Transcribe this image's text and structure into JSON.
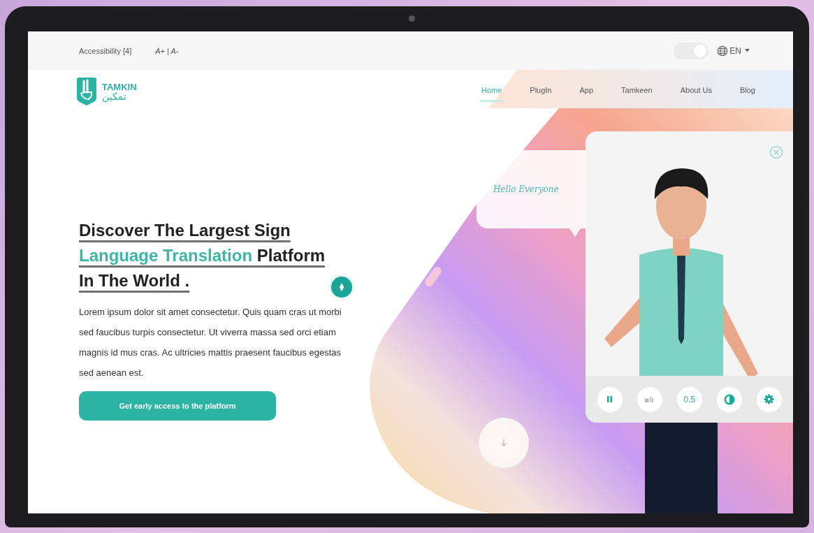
{
  "top_bar": {
    "accessibility_label": "Accessibility [4]",
    "font_size_controls": "A+ | A-",
    "dark_mode": {
      "on": true
    },
    "language": {
      "label": "EN"
    }
  },
  "brand": {
    "name": "TAMKIN",
    "name_arabic": "تمكين"
  },
  "nav": [
    {
      "label": "Home",
      "selected": true
    },
    {
      "label": "PlugIn",
      "selected": false
    },
    {
      "label": "App",
      "selected": false
    },
    {
      "label": "Tamkeen",
      "selected": false
    },
    {
      "label": "About Us",
      "selected": false
    },
    {
      "label": "Blog",
      "selected": false
    }
  ],
  "hero": {
    "heading_lines": [
      [
        {
          "text": "Discover The Largest Sign",
          "highlight": false
        }
      ],
      [
        {
          "text": "Language Translation",
          "highlight": true
        },
        {
          "text": " Platform",
          "highlight": false
        }
      ],
      [
        {
          "text": "In The World .",
          "highlight": false
        }
      ]
    ],
    "paragraph": "Lorem ipsum dolor sit amet consectetur. Quis quam cras ut morbi sed faucibus turpis consectetur. Ut viverra massa sed orci etiam magnis id mus cras. Ac ultricies mattis praesent faucibus egestas sed aenean est.",
    "cta_button": "Get early access to the platform"
  },
  "speech_bubble": {
    "text": "Hello Everyone"
  },
  "avatar_panel": {
    "controls": [
      {
        "kind": "pause"
      },
      {
        "kind": "sign"
      },
      {
        "kind": "speed",
        "label": "0.5"
      },
      {
        "kind": "contrast"
      },
      {
        "kind": "settings"
      }
    ]
  }
}
